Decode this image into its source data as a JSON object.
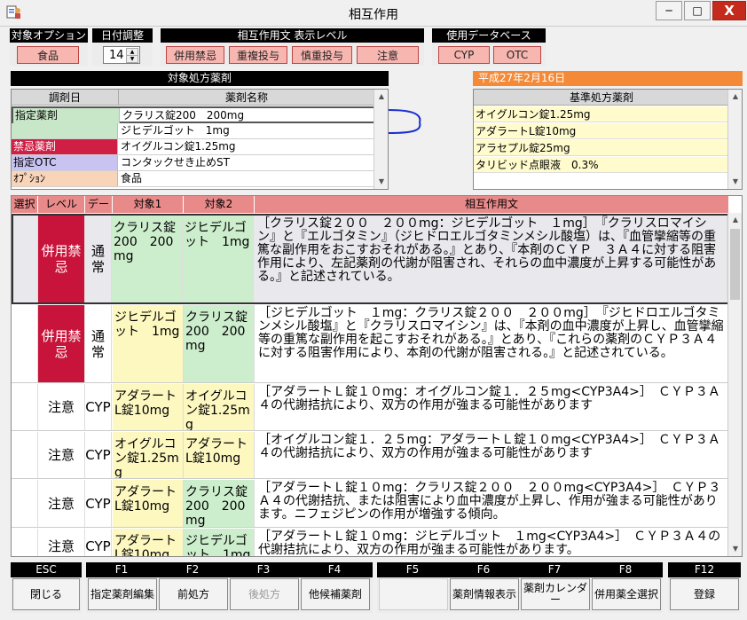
{
  "window": {
    "title": "相互作用",
    "controls": {
      "minimize": "─",
      "maximize": "□",
      "close": "X"
    }
  },
  "option_group": {
    "header": "対象オプション",
    "button": "食品"
  },
  "date_adjust": {
    "header": "日付調整",
    "value": "14"
  },
  "interaction_level": {
    "header": "相互作用文 表示レベル",
    "buttons": [
      "併用禁忌",
      "重複投与",
      "慎重投与",
      "注意"
    ]
  },
  "database": {
    "header": "使用データベース",
    "buttons": [
      "CYP",
      "OTC"
    ]
  },
  "target_rx": {
    "header": "対象処方薬剤",
    "col_date": "調剤日",
    "col_name": "薬剤名称",
    "rows": [
      {
        "label": "指定薬剤",
        "name": "クラリス錠200　200mg",
        "color": "#c8e6c8"
      },
      {
        "label": "",
        "name": "ジヒデルゴット　1mg",
        "color": "#c8e6c8"
      },
      {
        "label": "禁忌薬剤",
        "name": "オイグルコン錠1.25mg",
        "color": "#d01f44"
      },
      {
        "label": "指定OTC",
        "name": "コンタックせき止めST",
        "color": "#c9c3f2"
      },
      {
        "label": "ｵﾌﾟｼｮﾝ",
        "name": "食品",
        "color": "#f8d4b8"
      }
    ]
  },
  "base_rx": {
    "date": "平成27年2月16日",
    "header": "基準処方薬剤",
    "rows": [
      "オイグルコン錠1.25mg",
      "アダラートL錠10mg",
      "アラセプル錠25mg",
      "タリビッド点眼液　0.3%"
    ]
  },
  "interactions": {
    "headers": [
      "選択",
      "レベル",
      "データ",
      "対象1",
      "対象2",
      "相互作用文"
    ],
    "rows": [
      {
        "level": "併用禁忌",
        "data": "通常",
        "t1": "クラリス錠200　200mg",
        "t2": "ジヒデルゴット　1mg",
        "text": "［クラリス錠２００　２００mg：ジヒデルゴット　１mg］　『クラリスロマイシン』と『エルゴタミン』（ジヒドロエルゴタミンメシル酸塩）は、『血管攣縮等の重篤な副作用をおこすおそれがある。』とあり、『本剤のＣＹＰ　３Ａ４に対する阻害作用により、左記薬剤の代謝が阻害され、それらの血中濃度が上昇する可能性がある。』と記述されている。"
      },
      {
        "level": "併用禁忌",
        "data": "通常",
        "t1": "ジヒデルゴット　1mg",
        "t2": "クラリス錠200　200mg",
        "text": "［ジヒデルゴット　１mg：クラリス錠２００　２００mg］　『ジヒドロエルゴタミンメシル酸塩』と『クラリスロマイシン』は、『本剤の血中濃度が上昇し、血管攣縮等の重篤な副作用を起こすおそれがある。』とあり、『これらの薬剤のＣＹＰ３Ａ４に対する阻害作用により、本剤の代謝が阻害される。』と記述されている。"
      },
      {
        "level": "注意",
        "data": "CYP",
        "t1": "アダラートL錠10mg",
        "t2": "オイグルコン錠1.25mg",
        "text": "［アダラートＬ錠１０mg：オイグルコン錠１．２５mg<CYP3A4>］　ＣＹＰ３Ａ４の代謝拮抗により、双方の作用が強まる可能性があります"
      },
      {
        "level": "注意",
        "data": "CYP",
        "t1": "オイグルコン錠1.25mg",
        "t2": "アダラートL錠10mg",
        "text": "［オイグルコン錠１．２５mg：アダラートＬ錠１０mg<CYP3A4>］　ＣＹＰ３Ａ４の代謝拮抗により、双方の作用が強まる可能性があります"
      },
      {
        "level": "注意",
        "data": "CYP",
        "t1": "アダラートL錠10mg",
        "t2": "クラリス錠200　200mg",
        "text": "［アダラートＬ錠１０mg：クラリス錠２００　２００mg<CYP3A4>］　ＣＹＰ３Ａ４の代謝拮抗、または阻害により血中濃度が上昇し、作用が強まる可能性があります。ニフェジピンの作用が増強する傾向。"
      },
      {
        "level": "注意",
        "data": "CYP",
        "t1": "アダラートL錠10mg",
        "t2": "ジヒデルゴット　1mg",
        "text": "［アダラートＬ錠１０mg：ジヒデルゴット　１mg<CYP3A4>］　ＣＹＰ３Ａ４の代謝拮抗により、双方の作用が強まる可能性があります。"
      }
    ]
  },
  "fkeys": {
    "esc": {
      "key": "ESC",
      "label": "閉じる"
    },
    "f1": {
      "key": "F1",
      "label": "指定薬剤編集"
    },
    "f2": {
      "key": "F2",
      "label": "前処方"
    },
    "f3": {
      "key": "F3",
      "label": "後処方"
    },
    "f4": {
      "key": "F4",
      "label": "他候補薬剤"
    },
    "f5": {
      "key": "F5",
      "label": ""
    },
    "f6": {
      "key": "F6",
      "label": "薬剤情報表示"
    },
    "f7": {
      "key": "F7",
      "label": "薬剤カレンダー"
    },
    "f8": {
      "key": "F8",
      "label": "併用薬全選択"
    },
    "f12": {
      "key": "F12",
      "label": "登録"
    }
  },
  "colors": {
    "accent_red": "#f7b6b0",
    "level_red": "#c8143a",
    "date_orange": "#f48a38",
    "header_pink": "#e98a8a"
  }
}
